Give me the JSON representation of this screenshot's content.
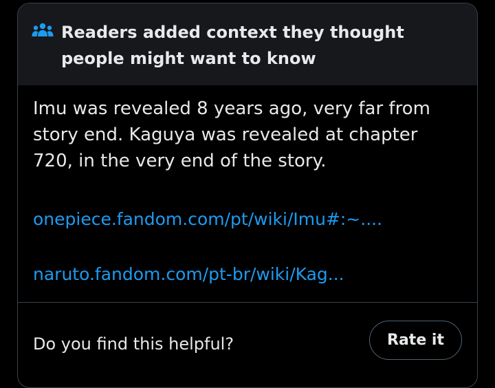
{
  "note": {
    "header": {
      "icon": "people-group-icon",
      "title": "Readers added context they thought people might want to know"
    },
    "body": "Imu was revealed 8 years ago, very far from story end. Kaguya was revealed at chapter 720, in the very end of the story.",
    "links": [
      "onepiece.fandom.com/pt/wiki/Imu#:~....",
      "naruto.fandom.com/pt-br/wiki/Kag..."
    ],
    "footer": {
      "question": "Do you find this helpful?",
      "rate_label": "Rate it"
    }
  },
  "colors": {
    "background": "#000000",
    "header_background": "#16181c",
    "text": "#e7e9ea",
    "link": "#1d9bf0",
    "border": "#38444d",
    "icon": "#1d9bf0"
  }
}
